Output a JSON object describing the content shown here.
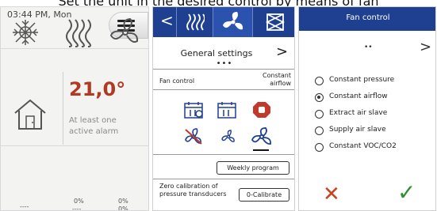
{
  "caption": "Set the unit in the desired control by means of fan",
  "home": {
    "time": "03:44 PM, Mon",
    "temperature": "21,0°",
    "alarm_text": "At least one active alarm",
    "bottom": {
      "frost_value": "----",
      "heater_value_1": "0%",
      "heater_value_2": "----",
      "fan_value_1": "0%",
      "fan_value_2": "0%"
    }
  },
  "general": {
    "nav_back": "<",
    "title": "General settings",
    "arrow": ">",
    "dots": "•••",
    "fan_control_label": "Fan control",
    "fan_control_value": "Constant airflow",
    "weekly_program_button": "Weekly program",
    "zero_calibration_label": "Zero calibration of pressure transducers",
    "calibrate_button": "0-Calibrate"
  },
  "fan_control": {
    "header": "Fan control",
    "dots": "••",
    "arrow": ">",
    "options": [
      {
        "label": "Constant pressure",
        "selected": false
      },
      {
        "label": "Constant airflow",
        "selected": true
      },
      {
        "label": "Extract air slave",
        "selected": false
      },
      {
        "label": "Supply air slave",
        "selected": false
      },
      {
        "label": "Constant VOC/CO2",
        "selected": false
      }
    ],
    "cancel": "✕",
    "confirm": "✓"
  },
  "colors": {
    "nav_blue": "#1f3f91",
    "temperature_red": "#b03a22",
    "cancel_orange": "#c9441c",
    "confirm_green": "#2f8f2f"
  },
  "icons": [
    "hamburger-menu-icon",
    "house-icon",
    "frost-protection-icon",
    "heater-icon",
    "fan-icon",
    "calendar-icon",
    "stop-icon",
    "fan-off-icon",
    "fan-low-icon",
    "fan-high-icon"
  ]
}
